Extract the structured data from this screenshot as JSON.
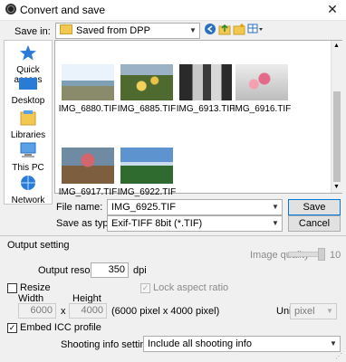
{
  "window": {
    "title": "Convert and save",
    "close_glyph": "✕"
  },
  "save_in": {
    "label": "Save in:",
    "value": "Saved from DPP"
  },
  "places": [
    {
      "label": "Quick access",
      "icon": "star-icon"
    },
    {
      "label": "Desktop",
      "icon": "desktop-icon"
    },
    {
      "label": "Libraries",
      "icon": "libraries-icon"
    },
    {
      "label": "This PC",
      "icon": "computer-icon"
    },
    {
      "label": "Network",
      "icon": "network-icon"
    }
  ],
  "files": [
    {
      "name": "IMG_6880.TIF"
    },
    {
      "name": "IMG_6885.TIF"
    },
    {
      "name": "IMG_6913.TIF"
    },
    {
      "name": "IMG_6916.TIF"
    },
    {
      "name": "IMG_6917.TIF"
    },
    {
      "name": "IMG_6922.TIF"
    }
  ],
  "file_name": {
    "label": "File name:",
    "value": "IMG_6925.TIF"
  },
  "save_as_type": {
    "label": "Save as type:",
    "value": "Exif-TIFF 8bit (*.TIF)"
  },
  "buttons": {
    "save": "Save",
    "cancel": "Cancel"
  },
  "output_setting": {
    "title": "Output setting",
    "image_quality_label": "Image quality",
    "image_quality_value": "10",
    "output_resolution_label": "Output resolution",
    "output_resolution_value": "350",
    "dpi_label": "dpi"
  },
  "resize": {
    "label": "Resize",
    "lock_aspect_label": "Lock aspect ratio",
    "width_label": "Width",
    "height_label": "Height",
    "width_value": "6000",
    "x_label": "x",
    "height_value": "4000",
    "pixel_summary": "(6000 pixel x 4000 pixel)",
    "unit_label": "Unit",
    "unit_value": "pixel"
  },
  "embed_icc": {
    "label": "Embed ICC profile",
    "checked": true
  },
  "shooting_info": {
    "label": "Shooting info setting",
    "value": "Include all shooting info"
  }
}
